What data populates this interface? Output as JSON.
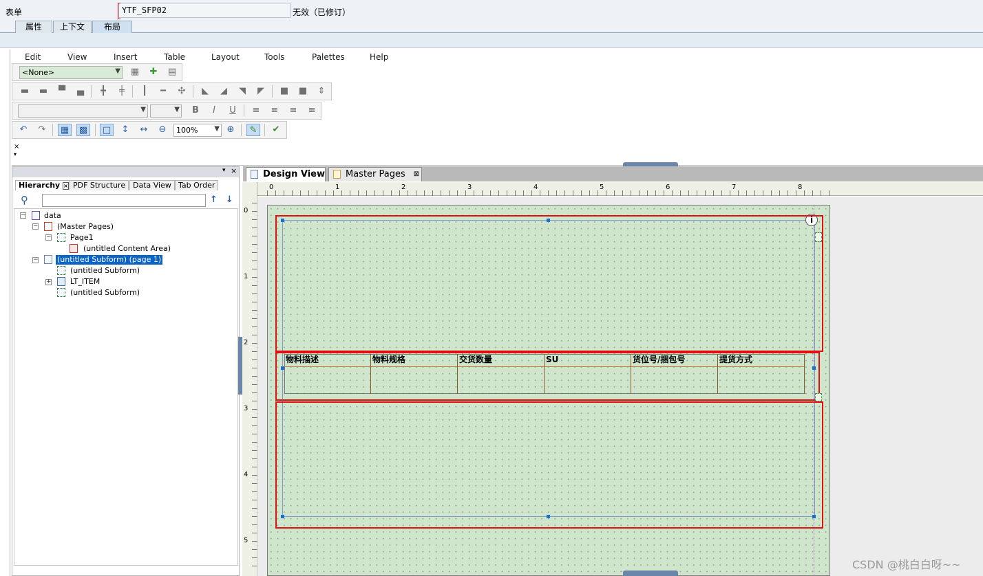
{
  "form": {
    "label": "表单",
    "value": "YTF_SFP02",
    "status": "无效（已修订）"
  },
  "top_tabs": [
    "属性",
    "上下文",
    "布局"
  ],
  "menu": [
    "Edit",
    "View",
    "Insert",
    "Table",
    "Layout",
    "Tools",
    "Palettes",
    "Help"
  ],
  "toolbar": {
    "style_combo": "<None>",
    "zoom": "100%"
  },
  "left_panel": {
    "tabs": [
      "Hierarchy",
      "PDF Structure",
      "Data View",
      "Tab Order"
    ],
    "tree": [
      "data",
      "(Master Pages)",
      "Page1",
      "(untitled Content Area)",
      "(untitled Subform) (page 1)",
      "(untitled Subform)",
      "LT_ITEM",
      "(untitled Subform)"
    ]
  },
  "design_tabs": [
    "Design View",
    "Master Pages"
  ],
  "ruler": {
    "top": [
      "0",
      "1",
      "2",
      "3",
      "4",
      "5",
      "6",
      "7",
      "8"
    ],
    "left": [
      "0",
      "1",
      "2",
      "3",
      "4",
      "5"
    ]
  },
  "table": {
    "headers": [
      "物料描述",
      "物料规格",
      "交货数量",
      "SU",
      "货位号/捆包号",
      "提货方式"
    ]
  },
  "watermark": "CSDN @桃白白呀~~",
  "colors": {
    "highlight": "#e01010",
    "page_green": "#cfe6cc",
    "selection": "#0a64c8"
  }
}
